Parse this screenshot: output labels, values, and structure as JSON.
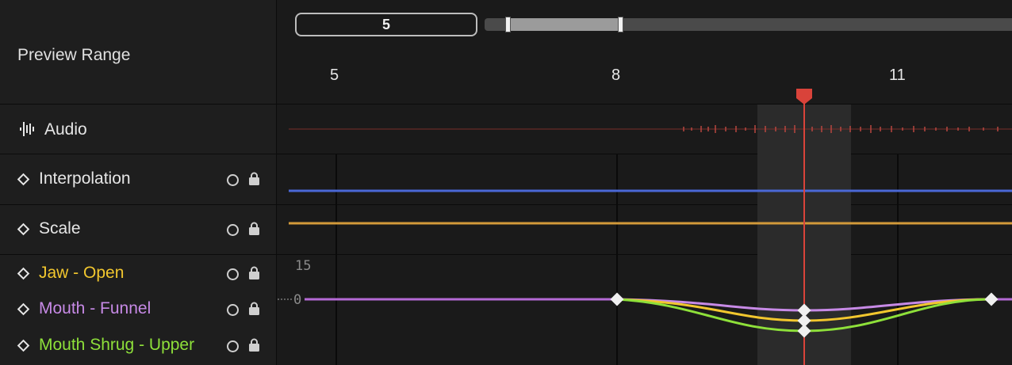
{
  "header": {
    "preview_range_label": "Preview Range",
    "range_value": "5",
    "ruler_labels": [
      "5",
      "8",
      "11"
    ]
  },
  "tracks": {
    "audio": {
      "label": "Audio",
      "icon": "waveform-icon"
    },
    "rows": [
      {
        "label": "Interpolation",
        "color": "#e6e6e6",
        "curve_color": "#4a68d6"
      },
      {
        "label": "Scale",
        "color": "#e6e6e6",
        "curve_color": "#d39a3a"
      },
      {
        "label": "Jaw - Open",
        "color": "#f2c72e",
        "curve_color": "#f2c72e"
      },
      {
        "label": "Mouth - Funnel",
        "color": "#c78ae6",
        "curve_color": "#c78ae6"
      },
      {
        "label": "Mouth Shrug - Upper",
        "color": "#8ee03a",
        "curve_color": "#8ee03a"
      }
    ]
  },
  "graph": {
    "max_value_label": "15",
    "zero_label": "0"
  },
  "colors": {
    "playhead": "#d9433a",
    "background": "#1a1a1a",
    "base_curve": "#b56ad6"
  }
}
